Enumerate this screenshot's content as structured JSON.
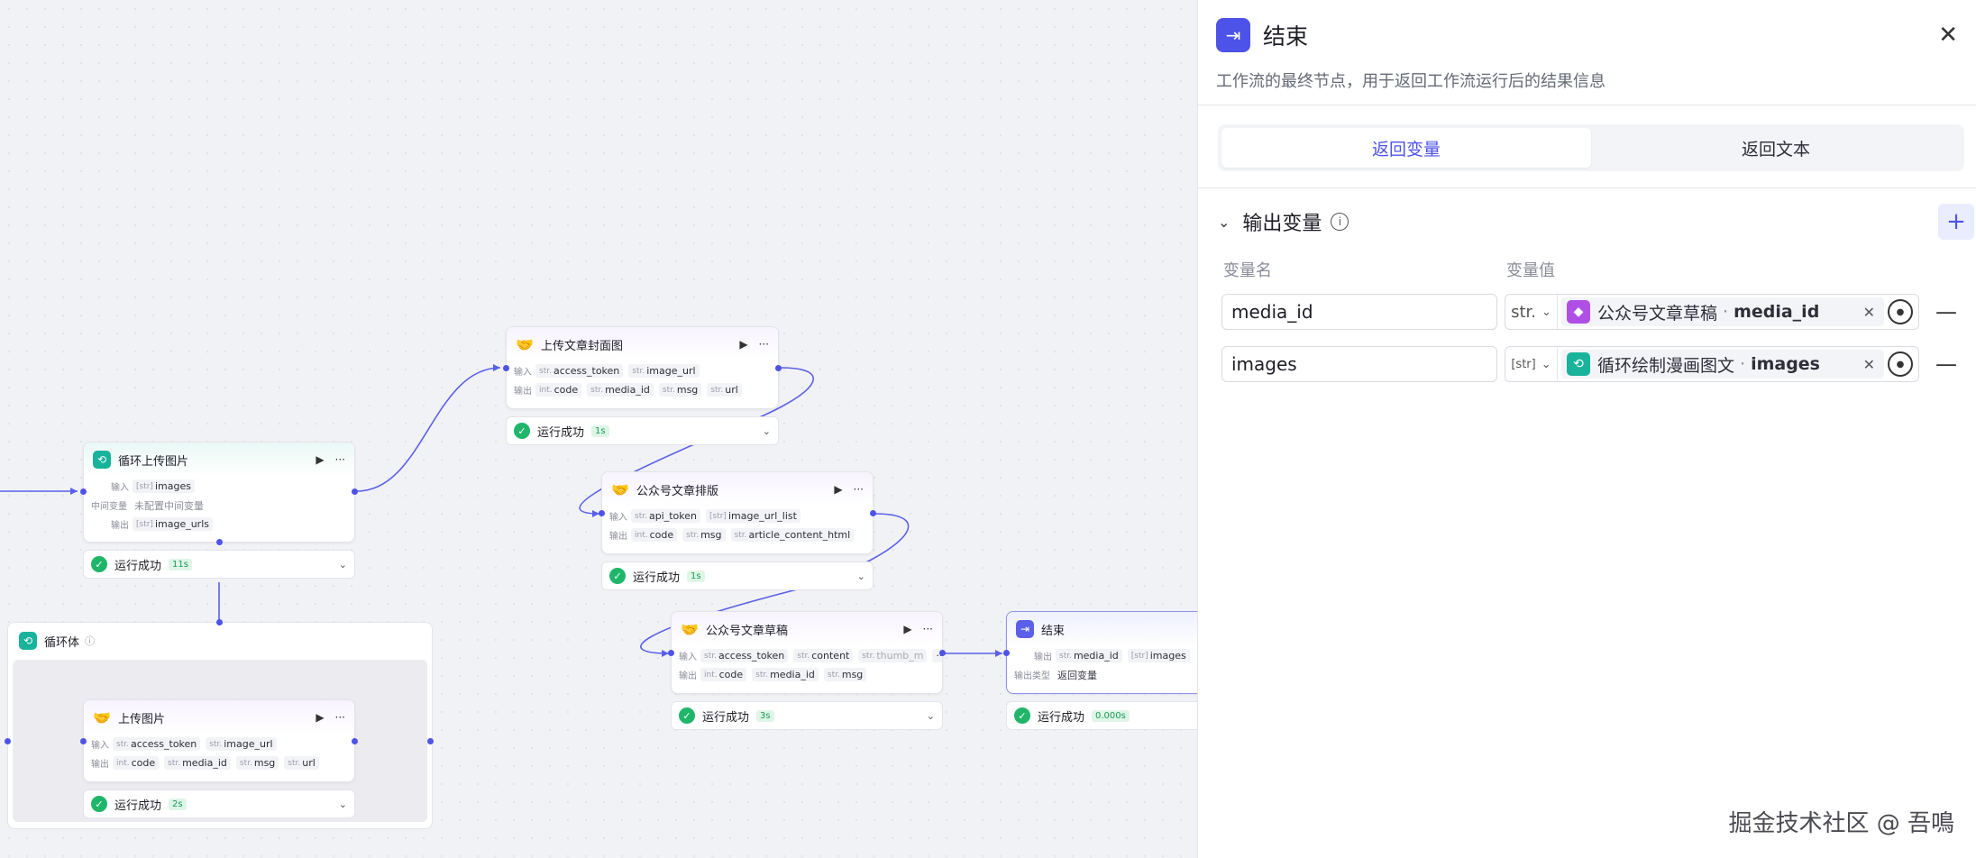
{
  "colors": {
    "accent": "#4d53e8",
    "success": "#1fb66a",
    "loop": "#19b39b",
    "plugin": "#b04fe6"
  },
  "labels": {
    "input": "输入",
    "output": "输出",
    "mid": "中间变量",
    "output_type": "输出类型"
  },
  "loop_upload": {
    "title": "循环上传图片",
    "input_type": "[str]",
    "input": "images",
    "mid_value": "未配置中间变量",
    "output_type": "[str]",
    "output": "image_urls",
    "status": "运行成功",
    "time": "11s"
  },
  "loop_body": {
    "title": "循环体"
  },
  "upload_image": {
    "title": "上传图片",
    "inputs": [
      {
        "t": "str.",
        "n": "access_token"
      },
      {
        "t": "str.",
        "n": "image_url"
      }
    ],
    "outputs": [
      {
        "t": "int.",
        "n": "code"
      },
      {
        "t": "str.",
        "n": "media_id"
      },
      {
        "t": "str.",
        "n": "msg"
      },
      {
        "t": "str.",
        "n": "url"
      }
    ],
    "status": "运行成功",
    "time": "2s"
  },
  "upload_cover": {
    "title": "上传文章封面图",
    "inputs": [
      {
        "t": "str.",
        "n": "access_token"
      },
      {
        "t": "str.",
        "n": "image_url"
      }
    ],
    "outputs": [
      {
        "t": "int.",
        "n": "code"
      },
      {
        "t": "str.",
        "n": "media_id"
      },
      {
        "t": "str.",
        "n": "msg"
      },
      {
        "t": "str.",
        "n": "url"
      }
    ],
    "status": "运行成功",
    "time": "1s"
  },
  "layout_node": {
    "title": "公众号文章排版",
    "inputs": [
      {
        "t": "str.",
        "n": "api_token"
      },
      {
        "t": "[str]",
        "n": "image_url_list"
      }
    ],
    "outputs": [
      {
        "t": "int.",
        "n": "code"
      },
      {
        "t": "str.",
        "n": "msg"
      },
      {
        "t": "str.",
        "n": "article_content_html"
      }
    ],
    "status": "运行成功",
    "time": "1s"
  },
  "draft_node": {
    "title": "公众号文章草稿",
    "inputs": [
      {
        "t": "str.",
        "n": "access_token"
      },
      {
        "t": "str.",
        "n": "content"
      },
      {
        "t": "str.",
        "n": "thumb_m"
      }
    ],
    "outputs": [
      {
        "t": "int.",
        "n": "code"
      },
      {
        "t": "str.",
        "n": "media_id"
      },
      {
        "t": "str.",
        "n": "msg"
      }
    ],
    "status": "运行成功",
    "time": "3s"
  },
  "end_node": {
    "title": "结束",
    "outputs": [
      {
        "t": "str.",
        "n": "media_id"
      },
      {
        "t": "[str]",
        "n": "images"
      }
    ],
    "output_type_value": "返回变量",
    "status": "运行成功",
    "time": "0.000s"
  },
  "panel": {
    "title": "结束",
    "description": "工作流的最终节点，用于返回工作流运行后的结果信息",
    "tabs": [
      "返回变量",
      "返回文本"
    ],
    "section_title": "输出变量",
    "col_name": "变量名",
    "col_value": "变量值",
    "rows": [
      {
        "name": "media_id",
        "type": "str.",
        "source_icon": "package-icon",
        "source": "公众号文章草稿",
        "field": "media_id"
      },
      {
        "name": "images",
        "type": "[str]",
        "source_icon": "loop-icon",
        "source": "循环绘制漫画图文",
        "field": "images"
      }
    ]
  },
  "watermark": "掘金技术社区 @ 吾鳴"
}
